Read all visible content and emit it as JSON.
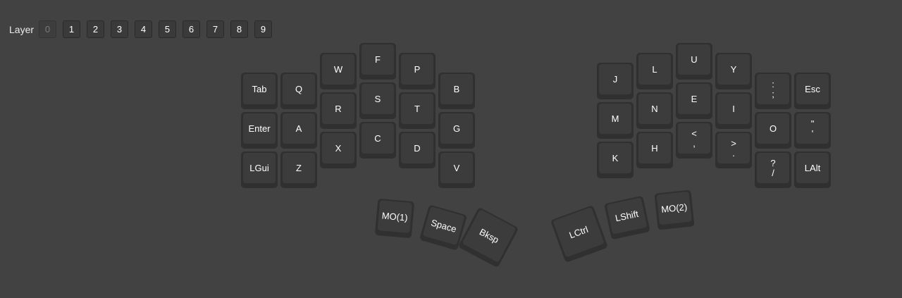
{
  "layer_bar": {
    "label": "Layer",
    "layers": [
      "0",
      "1",
      "2",
      "3",
      "4",
      "5",
      "6",
      "7",
      "8",
      "9"
    ],
    "active": "0"
  },
  "left_keys": [
    {
      "label": "Tab"
    },
    {
      "label": "Q"
    },
    {
      "label": "W"
    },
    {
      "label": "F"
    },
    {
      "label": "P"
    },
    {
      "label": "B"
    },
    {
      "label": "Enter"
    },
    {
      "label": "A"
    },
    {
      "label": "R"
    },
    {
      "label": "S"
    },
    {
      "label": "T"
    },
    {
      "label": "G"
    },
    {
      "label": "LGui"
    },
    {
      "label": "Z"
    },
    {
      "label": "X"
    },
    {
      "label": "C"
    },
    {
      "label": "D"
    },
    {
      "label": "V"
    }
  ],
  "right_keys": [
    {
      "label": "J"
    },
    {
      "label": "L"
    },
    {
      "label": "U"
    },
    {
      "label": "Y"
    },
    {
      "shift": ":",
      "base": ";"
    },
    {
      "label": "Esc"
    },
    {
      "label": "M"
    },
    {
      "label": "N"
    },
    {
      "label": "E"
    },
    {
      "label": "I"
    },
    {
      "label": "O"
    },
    {
      "shift": "\"",
      "base": "'"
    },
    {
      "label": "K"
    },
    {
      "label": "H"
    },
    {
      "shift": "<",
      "base": ","
    },
    {
      "shift": ">",
      "base": "."
    },
    {
      "shift": "?",
      "base": "/"
    },
    {
      "label": "LAlt"
    }
  ],
  "thumb_left": [
    "MO(1)",
    "Space",
    "Bksp"
  ],
  "thumb_right": [
    "LCtrl",
    "LShift",
    "MO(2)"
  ]
}
